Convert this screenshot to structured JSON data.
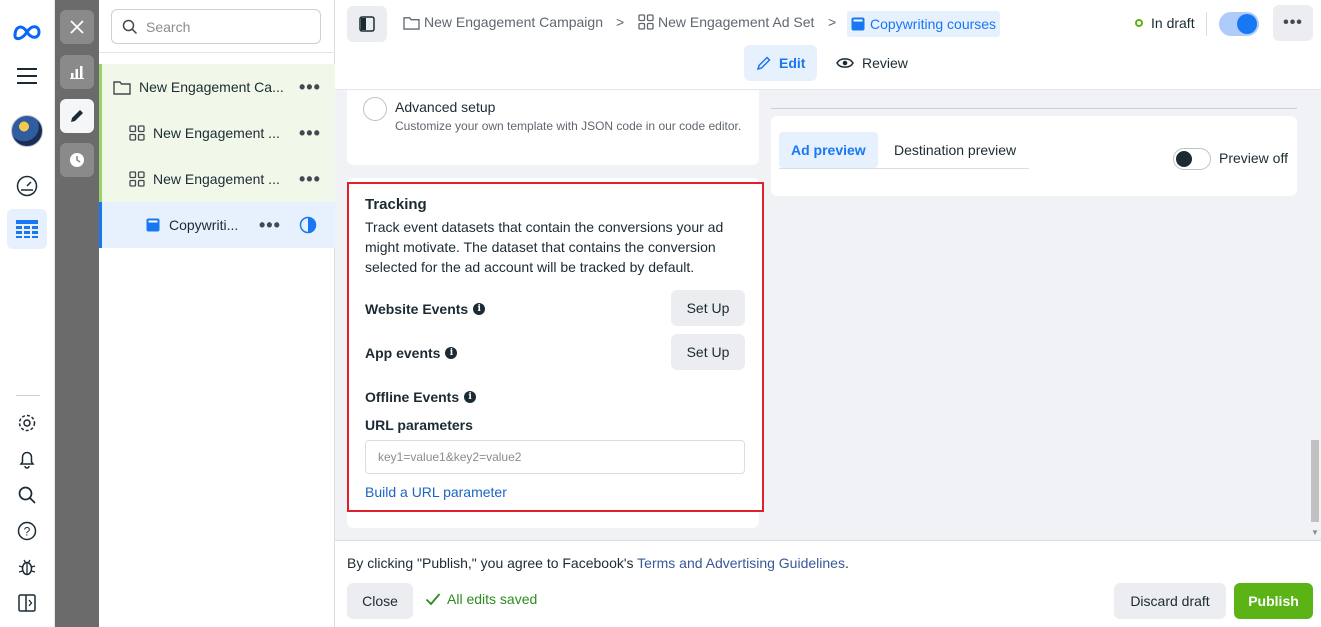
{
  "nav": {
    "icons": [
      "meta-logo-icon",
      "hamburger-menu-icon",
      "account-avatar",
      "dashboard-gauge-icon",
      "ads-manager-table-icon",
      "settings-gear-icon",
      "notifications-bell-icon",
      "search-icon",
      "help-icon",
      "bug-report-icon",
      "sidebar-toggle-icon"
    ]
  },
  "rail": {
    "icons": [
      "close-icon",
      "analytics-chart-icon",
      "edit-pencil-icon",
      "history-clock-icon"
    ]
  },
  "tree": {
    "search_placeholder": "Search",
    "items": [
      {
        "label": "New Engagement Ca...",
        "type": "campaign"
      },
      {
        "label": "New Engagement ...",
        "type": "ad-set"
      },
      {
        "label": "New Engagement ...",
        "type": "ad-set"
      },
      {
        "label": "Copywriti...",
        "type": "ad"
      }
    ]
  },
  "topbar": {
    "breadcrumbs": [
      "New Engagement Campaign",
      "New Engagement Ad Set",
      "Copywriting courses"
    ],
    "status": "In draft",
    "modes": {
      "edit": "Edit",
      "review": "Review"
    }
  },
  "advanced": {
    "title": "Advanced setup",
    "description": "Customize your own template with JSON code in our code editor."
  },
  "tracking": {
    "title": "Tracking",
    "description": "Track event datasets that contain the conversions your ad might motivate. The dataset that contains the conversion selected for the ad account will be tracked by default.",
    "website_events": "Website Events",
    "app_events": "App events",
    "offline_events": "Offline Events",
    "setup_label": "Set Up",
    "url_params_label": "URL parameters",
    "url_placeholder": "key1=value1&key2=value2",
    "build_link": "Build a URL parameter"
  },
  "preview": {
    "tab_ad": "Ad preview",
    "tab_destination": "Destination preview",
    "toggle_label": "Preview off"
  },
  "footer": {
    "legal_prefix": "By clicking \"Publish,\" you agree to Facebook's ",
    "legal_link": "Terms and Advertising Guidelines",
    "legal_suffix": ".",
    "close": "Close",
    "saved": "All edits saved",
    "discard": "Discard draft",
    "publish": "Publish"
  },
  "colors": {
    "accent_blue": "#1877f2",
    "publish_green": "#5bb315",
    "highlight_red": "#e0202a"
  }
}
